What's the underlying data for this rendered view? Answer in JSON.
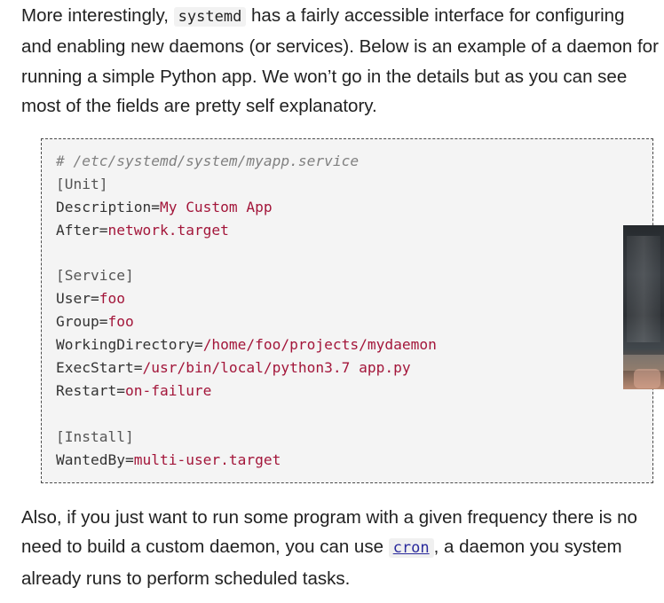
{
  "intro": {
    "line1_pre": "More interestingly, ",
    "line1_code": "systemd",
    "line1_post": " has a fairly accessible interface for configuring",
    "line2": "and enabling new daemons (or services). Below is an example of a daemon for",
    "line3": "running a simple Python app. We won’t go in the details but as you can see",
    "line4": "most of the fields are pretty self explanatory."
  },
  "code": {
    "comment": "# /etc/systemd/system/myapp.service",
    "unit_header": "[Unit]",
    "description_key": "Description=",
    "description_val": "My Custom App",
    "after_key": "After=",
    "after_val": "network.target",
    "service_header": "[Service]",
    "user_key": "User=",
    "user_val": "foo",
    "group_key": "Group=",
    "group_val": "foo",
    "workdir_key": "WorkingDirectory=",
    "workdir_val": "/home/foo/projects/mydaemon",
    "execstart_key": "ExecStart=",
    "execstart_val": "/usr/bin/local/python3.7 app.py",
    "restart_key": "Restart=",
    "restart_val": "on-failure",
    "install_header": "[Install]",
    "wantedby_key": "WantedBy=",
    "wantedby_val": "multi-user.target"
  },
  "outro": {
    "line1": "Also, if you just want to run some program with a given frequency there is no",
    "line2_pre": "need to build a custom daemon, you can use ",
    "line2_link": "cron",
    "line2_post": ", a daemon you system",
    "line3": "already runs to perform scheduled tasks."
  },
  "colors": {
    "code_value": "#a3163a",
    "code_comment": "#808080",
    "link": "#2a2a9c",
    "code_background": "#f4f4f4"
  }
}
